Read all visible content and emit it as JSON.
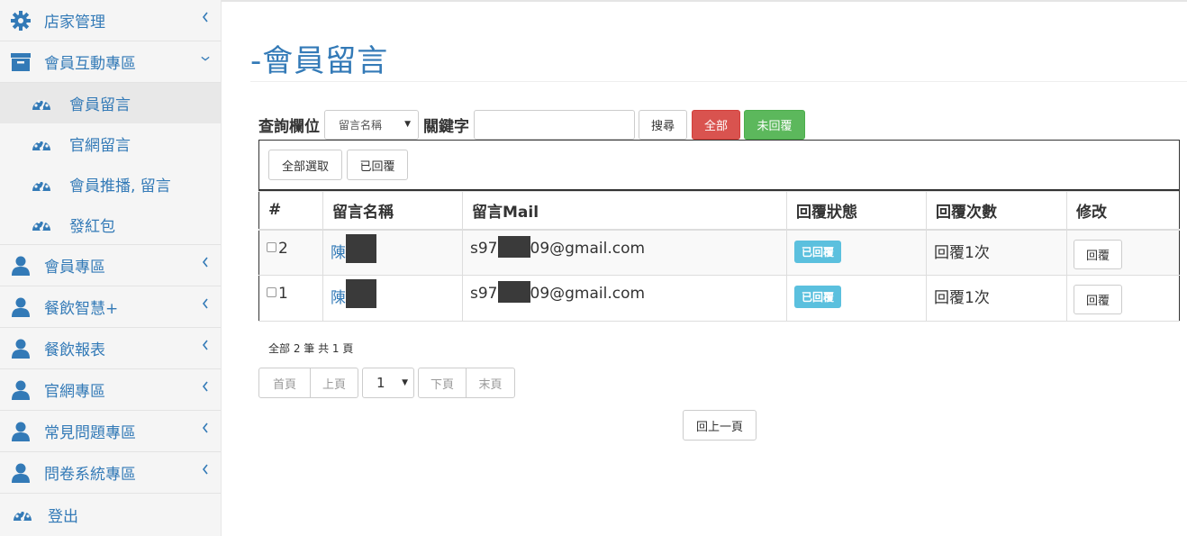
{
  "sidebar": {
    "items": [
      {
        "label": "店家管理",
        "icon": "gear-icon"
      },
      {
        "label": "會員互動專區",
        "icon": "archive-box-icon"
      },
      {
        "label": "會員專區",
        "icon": "user-icon"
      },
      {
        "label": "餐飲智慧+",
        "icon": "user-icon"
      },
      {
        "label": "餐飲報表",
        "icon": "user-icon"
      },
      {
        "label": "官網專區",
        "icon": "user-icon"
      },
      {
        "label": "常見問題專區",
        "icon": "user-icon"
      },
      {
        "label": "問卷系統專區",
        "icon": "user-icon"
      },
      {
        "label": "登出",
        "icon": "dashboard-icon"
      }
    ],
    "subitems": [
      {
        "label": "會員留言",
        "icon": "dashboard-icon"
      },
      {
        "label": "官網留言",
        "icon": "dashboard-icon"
      },
      {
        "label": "會員推播, 留言",
        "icon": "dashboard-icon"
      },
      {
        "label": "發紅包",
        "icon": "dashboard-icon"
      }
    ]
  },
  "page": {
    "title": "-會員留言"
  },
  "search": {
    "field_label": "查詢欄位",
    "field_value": "留言名稱",
    "keyword_label": "關鍵字",
    "keyword_value": "",
    "search_button": "搜尋",
    "all_button": "全部",
    "unreplied_button": "未回覆"
  },
  "actions": {
    "select_all": "全部選取",
    "replied": "已回覆"
  },
  "table": {
    "headers": [
      "#",
      "留言名稱",
      "留言Mail",
      "回覆狀態",
      "回覆次數",
      "修改"
    ],
    "rows": [
      {
        "id": "2",
        "name": "陳",
        "mail_prefix": "s97",
        "mail_suffix": "09@gmail.com",
        "status": "已回覆",
        "count": "回覆1次",
        "action": "回覆"
      },
      {
        "id": "1",
        "name": "陳",
        "mail_prefix": "s97",
        "mail_suffix": "09@gmail.com",
        "status": "已回覆",
        "count": "回覆1次",
        "action": "回覆"
      }
    ]
  },
  "pagination": {
    "summary": "全部 2 筆 共 1 頁",
    "first": "首頁",
    "prev": "上頁",
    "current": "1",
    "next": "下頁",
    "last": "末頁",
    "back": "回上一頁"
  },
  "colors": {
    "accent": "#337ab7",
    "danger": "#d9534f",
    "success": "#5cb85c",
    "info": "#5bc0de"
  }
}
